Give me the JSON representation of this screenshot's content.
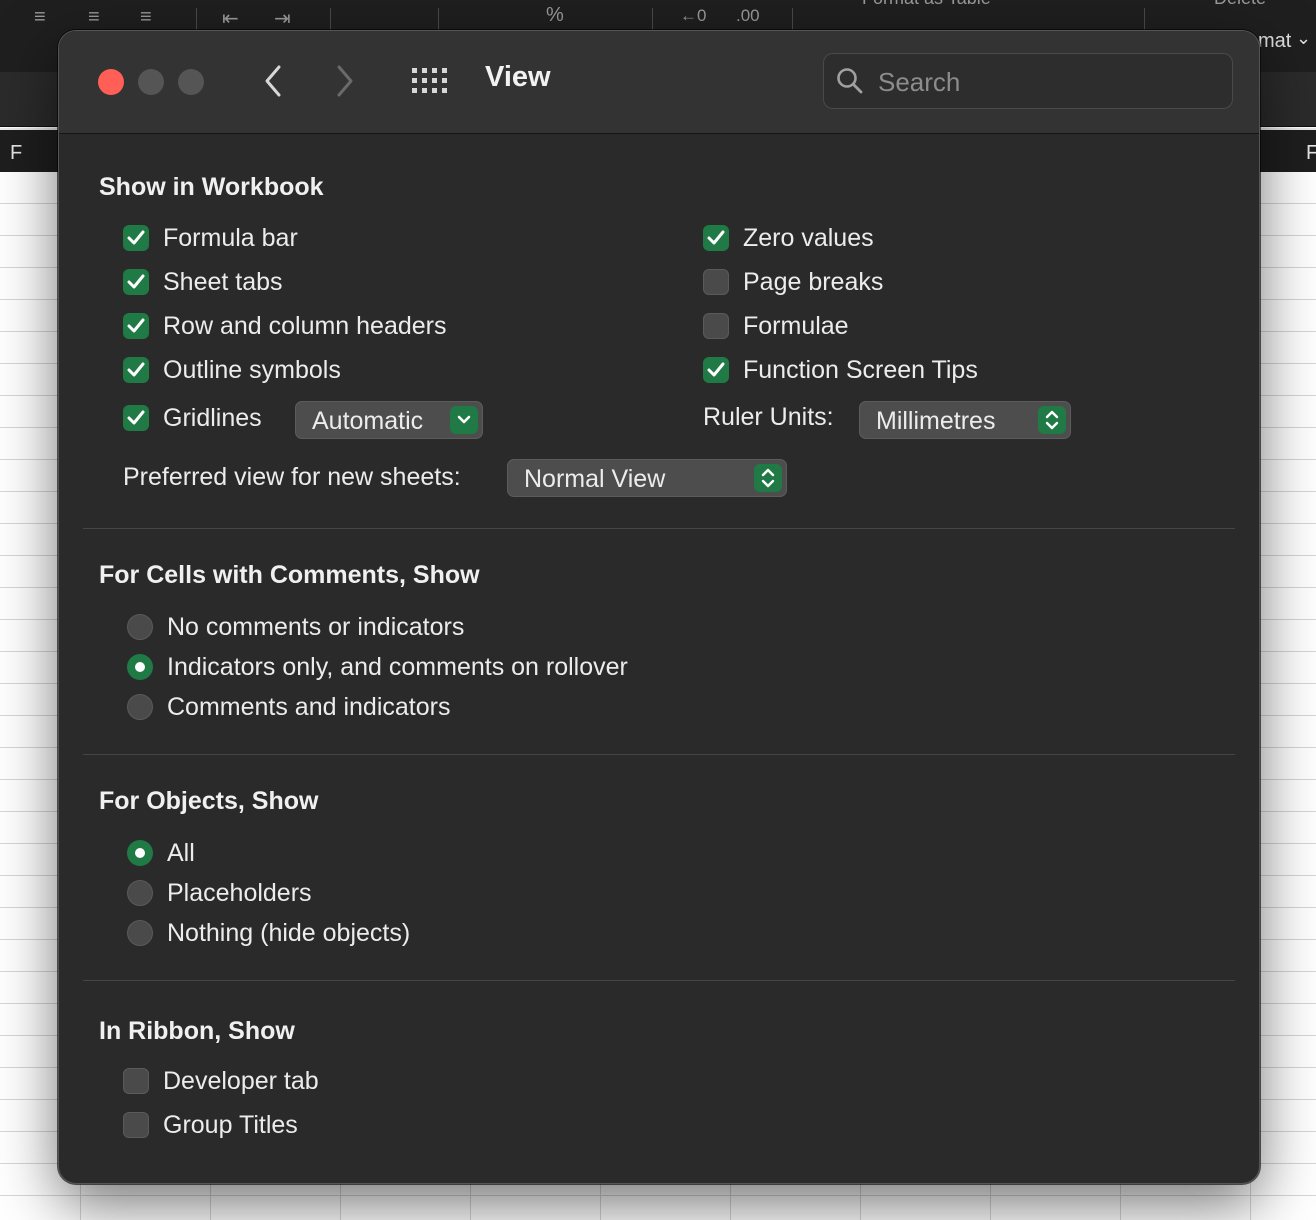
{
  "background": {
    "toolbar_fragments": {
      "format_as_table": "Format as Table",
      "delete": "Delete",
      "format": "mat"
    },
    "column_letters": [
      "F",
      "F"
    ]
  },
  "dialog": {
    "title": "View",
    "search": {
      "placeholder": "Search",
      "value": ""
    },
    "show_in_workbook": {
      "title": "Show in Workbook",
      "left": [
        {
          "label": "Formula bar",
          "checked": true
        },
        {
          "label": "Sheet tabs",
          "checked": true
        },
        {
          "label": "Row and column headers",
          "checked": true
        },
        {
          "label": "Outline symbols",
          "checked": true
        },
        {
          "label": "Gridlines",
          "checked": true
        }
      ],
      "right": [
        {
          "label": "Zero values",
          "checked": true
        },
        {
          "label": "Page breaks",
          "checked": false
        },
        {
          "label": "Formulae",
          "checked": false
        },
        {
          "label": "Function Screen Tips",
          "checked": true
        }
      ],
      "gridlines_color": "Automatic",
      "ruler_units_label": "Ruler Units:",
      "ruler_units_value": "Millimetres",
      "preferred_view_label": "Preferred view for new sheets:",
      "preferred_view_value": "Normal View"
    },
    "comments": {
      "title": "For Cells with Comments, Show",
      "options": [
        {
          "label": "No comments or indicators",
          "selected": false
        },
        {
          "label": "Indicators only, and comments on rollover",
          "selected": true
        },
        {
          "label": "Comments and indicators",
          "selected": false
        }
      ]
    },
    "objects": {
      "title": "For Objects, Show",
      "options": [
        {
          "label": "All",
          "selected": true
        },
        {
          "label": "Placeholders",
          "selected": false
        },
        {
          "label": "Nothing (hide objects)",
          "selected": false
        }
      ]
    },
    "ribbon": {
      "title": "In Ribbon, Show",
      "options": [
        {
          "label": "Developer tab",
          "checked": false
        },
        {
          "label": "Group Titles",
          "checked": false
        }
      ]
    }
  },
  "colors": {
    "accent": "#1f7a45",
    "close": "#ff5f57",
    "panel": "#2a2a2a"
  }
}
